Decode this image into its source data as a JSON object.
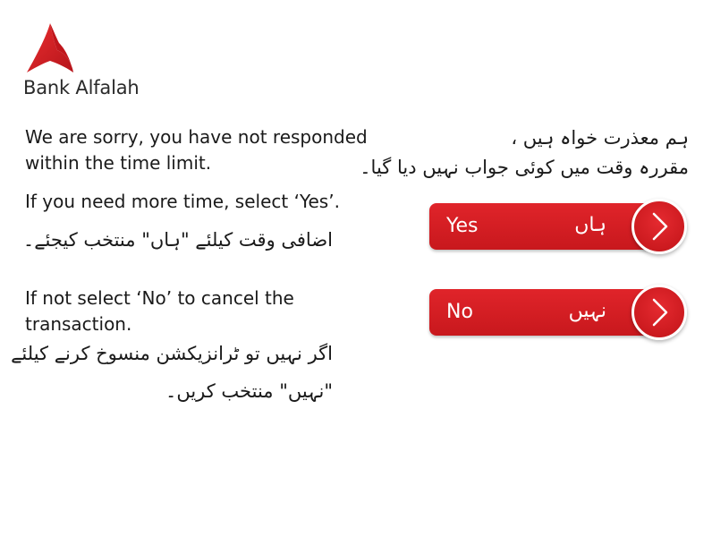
{
  "brand": {
    "name": "Bank Alfalah",
    "color": "#d71f26"
  },
  "timeout_message": {
    "en_line1": "We are sorry, you have not responded",
    "en_line2": "within the time limit.",
    "ur_line1": "ہم معذرت خواہ ہیں ،",
    "ur_line2": "مقررہ وقت میں کوئی جواب نہیں دیا گیا۔"
  },
  "yes_instruction": {
    "en": "If you need more time, select ‘Yes’.",
    "ur": "اضافی وقت کیلئے \"ہاں\" منتخب کیجئے۔"
  },
  "no_instruction": {
    "en_line1": "If not select ‘No’ to cancel the",
    "en_line2": "transaction.",
    "ur_line1": "اگر نہیں تو ٹرانزیکشن منسوخ کرنے کیلئے",
    "ur_line2": "\"نہیں\" منتخب کریں۔"
  },
  "buttons": {
    "yes": {
      "label_en": "Yes",
      "label_ur": "ہاں",
      "icon": "chevron-right-icon"
    },
    "no": {
      "label_en": "No",
      "label_ur": "نہیں",
      "icon": "chevron-right-icon"
    }
  }
}
